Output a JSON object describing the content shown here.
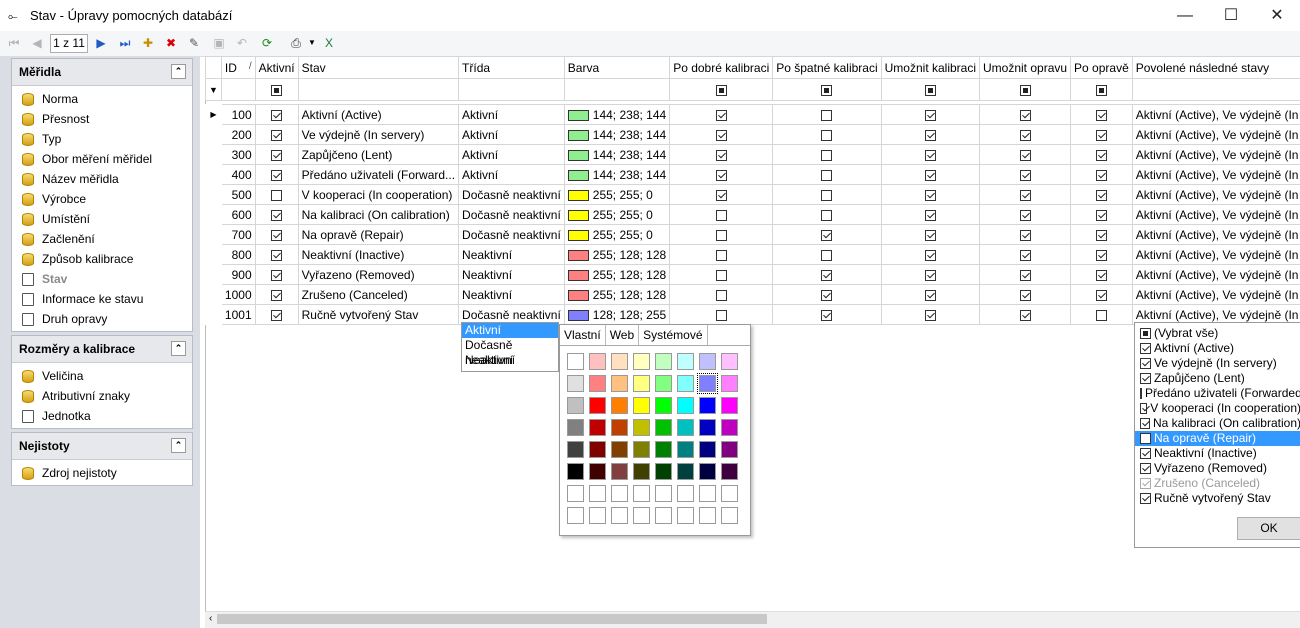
{
  "window": {
    "title": "Stav - Úpravy pomocných databází",
    "minimize": "—",
    "maximize": "☐",
    "close": "✕"
  },
  "toolbar": {
    "pager": "1 z 11",
    "icons": [
      "first-icon",
      "prev-icon",
      "next-icon",
      "last-icon",
      "new-icon",
      "delete-icon",
      "edit-icon",
      "save-icon",
      "undo-icon",
      "refresh-icon",
      "print-icon",
      "export-excel-icon"
    ]
  },
  "sidebar": {
    "groups": [
      {
        "title": "Měřidla",
        "items": [
          "Norma",
          "Přesnost",
          "Typ",
          "Obor měření měřidel",
          "Název měřidla",
          "Výrobce",
          "Umístění",
          "Začlenění",
          "Způsob kalibrace",
          "Stav",
          "Informace ke stavu",
          "Druh opravy"
        ]
      },
      {
        "title": "Rozměry a kalibrace",
        "items": [
          "Veličina",
          "Atributivní znaky",
          "Jednotka"
        ]
      },
      {
        "title": "Nejistoty",
        "items": [
          "Zdroj nejistoty"
        ]
      }
    ]
  },
  "grid": {
    "headers": [
      "ID",
      "Aktivní",
      "Stav",
      "Třída",
      "Barva",
      "Po dobré kalibraci",
      "Po špatné kalibraci",
      "Umožnit kalibraci",
      "Umožnit opravu",
      "Po opravě",
      "Povolené následné stavy"
    ],
    "sort_indicator": "/",
    "rows": [
      {
        "id": "100",
        "aktivni": true,
        "stav": "Aktivní (Active)",
        "trida": "Aktivní",
        "barva": "144; 238; 144",
        "color": "#90ee90",
        "dobre": true,
        "spatne": false,
        "umoznit_kal": true,
        "umoznit_opr": true,
        "po_oprave": true,
        "povolene": "Aktivní (Active), Ve výdejně (In s"
      },
      {
        "id": "200",
        "aktivni": true,
        "stav": "Ve výdejně (In servery)",
        "trida": "Aktivní",
        "barva": "144; 238; 144",
        "color": "#90ee90",
        "dobre": true,
        "spatne": false,
        "umoznit_kal": true,
        "umoznit_opr": true,
        "po_oprave": true,
        "povolene": "Aktivní (Active), Ve výdejně (In s"
      },
      {
        "id": "300",
        "aktivni": true,
        "stav": "Zapůjčeno (Lent)",
        "trida": "Aktivní",
        "barva": "144; 238; 144",
        "color": "#90ee90",
        "dobre": true,
        "spatne": false,
        "umoznit_kal": true,
        "umoznit_opr": true,
        "po_oprave": true,
        "povolene": "Aktivní (Active), Ve výdejně (In s"
      },
      {
        "id": "400",
        "aktivni": true,
        "stav": "Předáno uživateli (Forward...",
        "trida": "Aktivní",
        "barva": "144; 238; 144",
        "color": "#90ee90",
        "dobre": true,
        "spatne": false,
        "umoznit_kal": true,
        "umoznit_opr": true,
        "po_oprave": true,
        "povolene": "Aktivní (Active), Ve výdejně (In s"
      },
      {
        "id": "500",
        "aktivni": false,
        "stav": "V kooperaci (In cooperation)",
        "trida": "Dočasně neaktivní",
        "barva": "255; 255; 0",
        "color": "#ffff00",
        "dobre": true,
        "spatne": false,
        "umoznit_kal": true,
        "umoznit_opr": true,
        "po_oprave": true,
        "povolene": "Aktivní (Active), Ve výdejně (In s"
      },
      {
        "id": "600",
        "aktivni": true,
        "stav": "Na kalibraci (On calibration)",
        "trida": "Dočasně neaktivní",
        "barva": "255; 255; 0",
        "color": "#ffff00",
        "dobre": false,
        "spatne": false,
        "umoznit_kal": true,
        "umoznit_opr": true,
        "po_oprave": true,
        "povolene": "Aktivní (Active), Ve výdejně (In s"
      },
      {
        "id": "700",
        "aktivni": true,
        "stav": "Na opravě (Repair)",
        "trida": "Dočasně neaktivní",
        "barva": "255; 255; 0",
        "color": "#ffff00",
        "dobre": false,
        "spatne": true,
        "umoznit_kal": true,
        "umoznit_opr": true,
        "po_oprave": true,
        "povolene": "Aktivní (Active), Ve výdejně (In s"
      },
      {
        "id": "800",
        "aktivni": true,
        "stav": "Neaktivní (Inactive)",
        "trida": "Neaktivní",
        "barva": "255; 128; 128",
        "color": "#ff8080",
        "dobre": false,
        "spatne": false,
        "umoznit_kal": true,
        "umoznit_opr": true,
        "po_oprave": true,
        "povolene": "Aktivní (Active), Ve výdejně (In s"
      },
      {
        "id": "900",
        "aktivni": true,
        "stav": "Vyřazeno (Removed)",
        "trida": "Neaktivní",
        "barva": "255; 128; 128",
        "color": "#ff8080",
        "dobre": false,
        "spatne": true,
        "umoznit_kal": true,
        "umoznit_opr": true,
        "po_oprave": true,
        "povolene": "Aktivní (Active), Ve výdejně (In s"
      },
      {
        "id": "1000",
        "aktivni": true,
        "stav": "Zrušeno (Canceled)",
        "trida": "Neaktivní",
        "barva": "255; 128; 128",
        "color": "#ff8080",
        "dobre": false,
        "spatne": true,
        "umoznit_kal": true,
        "umoznit_opr": true,
        "po_oprave": true,
        "povolene": "Aktivní (Active), Ve výdejně (In s"
      },
      {
        "id": "1001",
        "aktivni": true,
        "stav": "Ručně vytvořený Stav",
        "trida": "Dočasně neaktivní",
        "barva": "128; 128; 255",
        "color": "#8080ff",
        "dobre": false,
        "spatne": true,
        "umoznit_kal": true,
        "umoznit_opr": true,
        "po_oprave": false,
        "povolene": "Aktivní (Active), Ve výdejně (In s"
      }
    ]
  },
  "class_dropdown": {
    "options": [
      "Aktivní",
      "Dočasně neaktivní",
      "Neaktivní"
    ],
    "selected": 0
  },
  "color_picker": {
    "tabs": [
      "Vlastní",
      "Web",
      "Systémové"
    ],
    "active_tab": 0,
    "rows": [
      [
        "#ffffff",
        "#ffc0c0",
        "#ffe0c0",
        "#ffffc0",
        "#c0ffc0",
        "#c0ffff",
        "#c0c0ff",
        "#ffc0ff"
      ],
      [
        "#e0e0e0",
        "#ff8080",
        "#ffc080",
        "#ffff80",
        "#80ff80",
        "#80ffff",
        "#8080ff",
        "#ff80ff"
      ],
      [
        "#c0c0c0",
        "#ff0000",
        "#ff8000",
        "#ffff00",
        "#00ff00",
        "#00ffff",
        "#0000ff",
        "#ff00ff"
      ],
      [
        "#808080",
        "#c00000",
        "#c04000",
        "#c0c000",
        "#00c000",
        "#00c0c0",
        "#0000c0",
        "#c000c0"
      ],
      [
        "#404040",
        "#800000",
        "#804000",
        "#808000",
        "#008000",
        "#008080",
        "#000080",
        "#800080"
      ],
      [
        "#000000",
        "#400000",
        "#804040",
        "#404000",
        "#004000",
        "#004040",
        "#000040",
        "#400040"
      ],
      [
        "#ffffff",
        "#ffffff",
        "#ffffff",
        "#ffffff",
        "#ffffff",
        "#ffffff",
        "#ffffff",
        "#ffffff"
      ],
      [
        "#ffffff",
        "#ffffff",
        "#ffffff",
        "#ffffff",
        "#ffffff",
        "#ffffff",
        "#ffffff",
        "#ffffff"
      ]
    ]
  },
  "filter_popup": {
    "items": [
      {
        "label": "(Vybrat vše)",
        "state": "ind"
      },
      {
        "label": "Aktivní (Active)",
        "state": "on"
      },
      {
        "label": "Ve výdejně (In servery)",
        "state": "on"
      },
      {
        "label": "Zapůjčeno (Lent)",
        "state": "on"
      },
      {
        "label": "Předáno uživateli (Forwarded t",
        "state": "off"
      },
      {
        "label": "V kooperaci (In cooperation)",
        "state": "on"
      },
      {
        "label": "Na kalibraci (On calibration)",
        "state": "on"
      },
      {
        "label": "Na opravě (Repair)",
        "state": "off",
        "selected": true
      },
      {
        "label": "Neaktivní (Inactive)",
        "state": "on"
      },
      {
        "label": "Vyřazeno (Removed)",
        "state": "on"
      },
      {
        "label": "Zrušeno (Canceled)",
        "state": "dis"
      },
      {
        "label": "Ručně vytvořený Stav",
        "state": "on"
      }
    ],
    "ok_label": "OK"
  }
}
